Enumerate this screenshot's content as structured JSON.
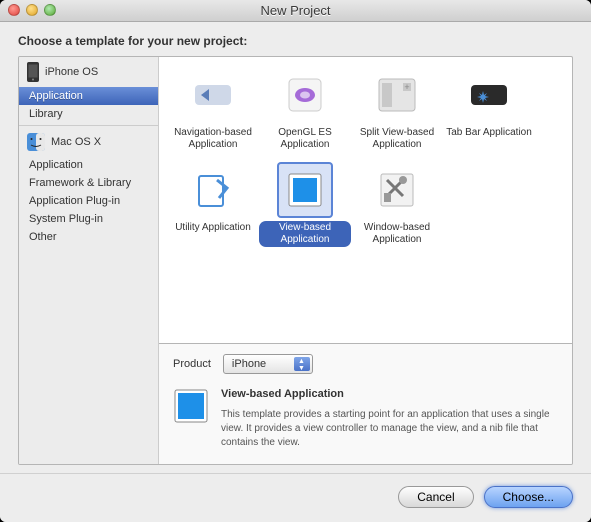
{
  "window": {
    "title": "New Project"
  },
  "prompt": "Choose a template for your new project:",
  "sidebar": {
    "iphone": {
      "header": "iPhone OS",
      "items": [
        "Application",
        "Library"
      ]
    },
    "macosx": {
      "header": "Mac OS X",
      "items": [
        "Application",
        "Framework & Library",
        "Application Plug-in",
        "System Plug-in",
        "Other"
      ]
    }
  },
  "templates": [
    {
      "label": "Navigation-based Application"
    },
    {
      "label": "OpenGL ES Application"
    },
    {
      "label": "Split View-based Application"
    },
    {
      "label": "Tab Bar Application"
    },
    {
      "label": "Utility Application"
    },
    {
      "label": "View-based Application"
    },
    {
      "label": "Window-based Application"
    }
  ],
  "product": {
    "label": "Product",
    "selected": "iPhone"
  },
  "detail": {
    "title": "View-based Application",
    "description": "This template provides a starting point for an application that uses a single view. It provides a view controller to manage the view, and a nib file that contains the view."
  },
  "buttons": {
    "cancel": "Cancel",
    "choose": "Choose..."
  }
}
